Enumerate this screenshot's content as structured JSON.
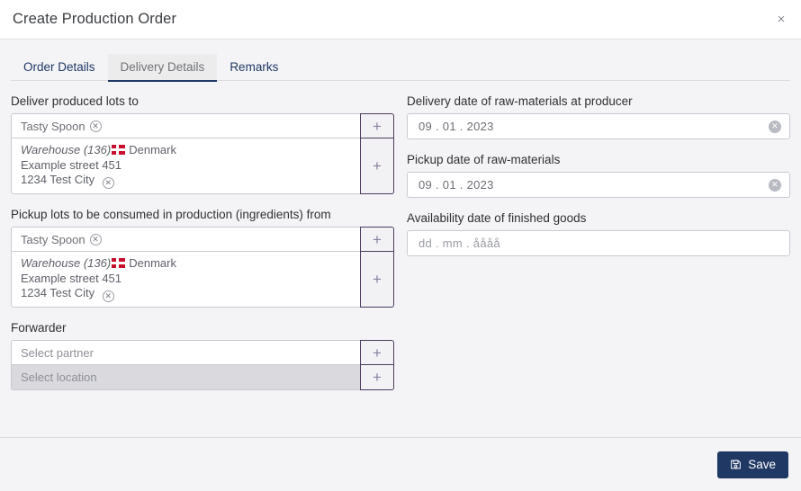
{
  "header": {
    "title": "Create Production Order",
    "close_label": "×"
  },
  "tabs": [
    {
      "label": "Order Details",
      "active": false
    },
    {
      "label": "Delivery Details",
      "active": true
    },
    {
      "label": "Remarks",
      "active": false
    }
  ],
  "left_column": {
    "deliver_lots": {
      "label": "Deliver produced lots to",
      "partner_value": "Tasty Spoon",
      "clear_icon": "clear-circle-icon",
      "add_label": "+",
      "location": {
        "name": "Warehouse (136)",
        "country": "Denmark",
        "flag": "denmark-flag-icon",
        "street": "Example street 451",
        "city": "1234 Test City"
      }
    },
    "pickup_lots": {
      "label": "Pickup lots to be consumed in production (ingredients) from",
      "partner_value": "Tasty Spoon",
      "add_label": "+",
      "location": {
        "name": "Warehouse (136)",
        "country": "Denmark",
        "flag": "denmark-flag-icon",
        "street": "Example street 451",
        "city": "1234 Test City"
      }
    },
    "forwarder": {
      "label": "Forwarder",
      "partner_placeholder": "Select partner",
      "location_placeholder": "Select location",
      "add_label": "+"
    }
  },
  "right_column": {
    "delivery_date": {
      "label": "Delivery date of raw-materials at producer",
      "value": "09 . 01 . 2023"
    },
    "pickup_date": {
      "label": "Pickup date of raw-materials",
      "value": "09 . 01 . 2023"
    },
    "availability_date": {
      "label": "Availability date of finished goods",
      "value": "dd . mm . åååå"
    }
  },
  "footer": {
    "save_label": "Save",
    "save_icon": "save-floppy-icon"
  },
  "colors": {
    "accent_navy": "#1f3864",
    "plus_border": "#4a3a5e",
    "flag_red": "#c8102e",
    "body_bg": "#f4f4f6"
  }
}
